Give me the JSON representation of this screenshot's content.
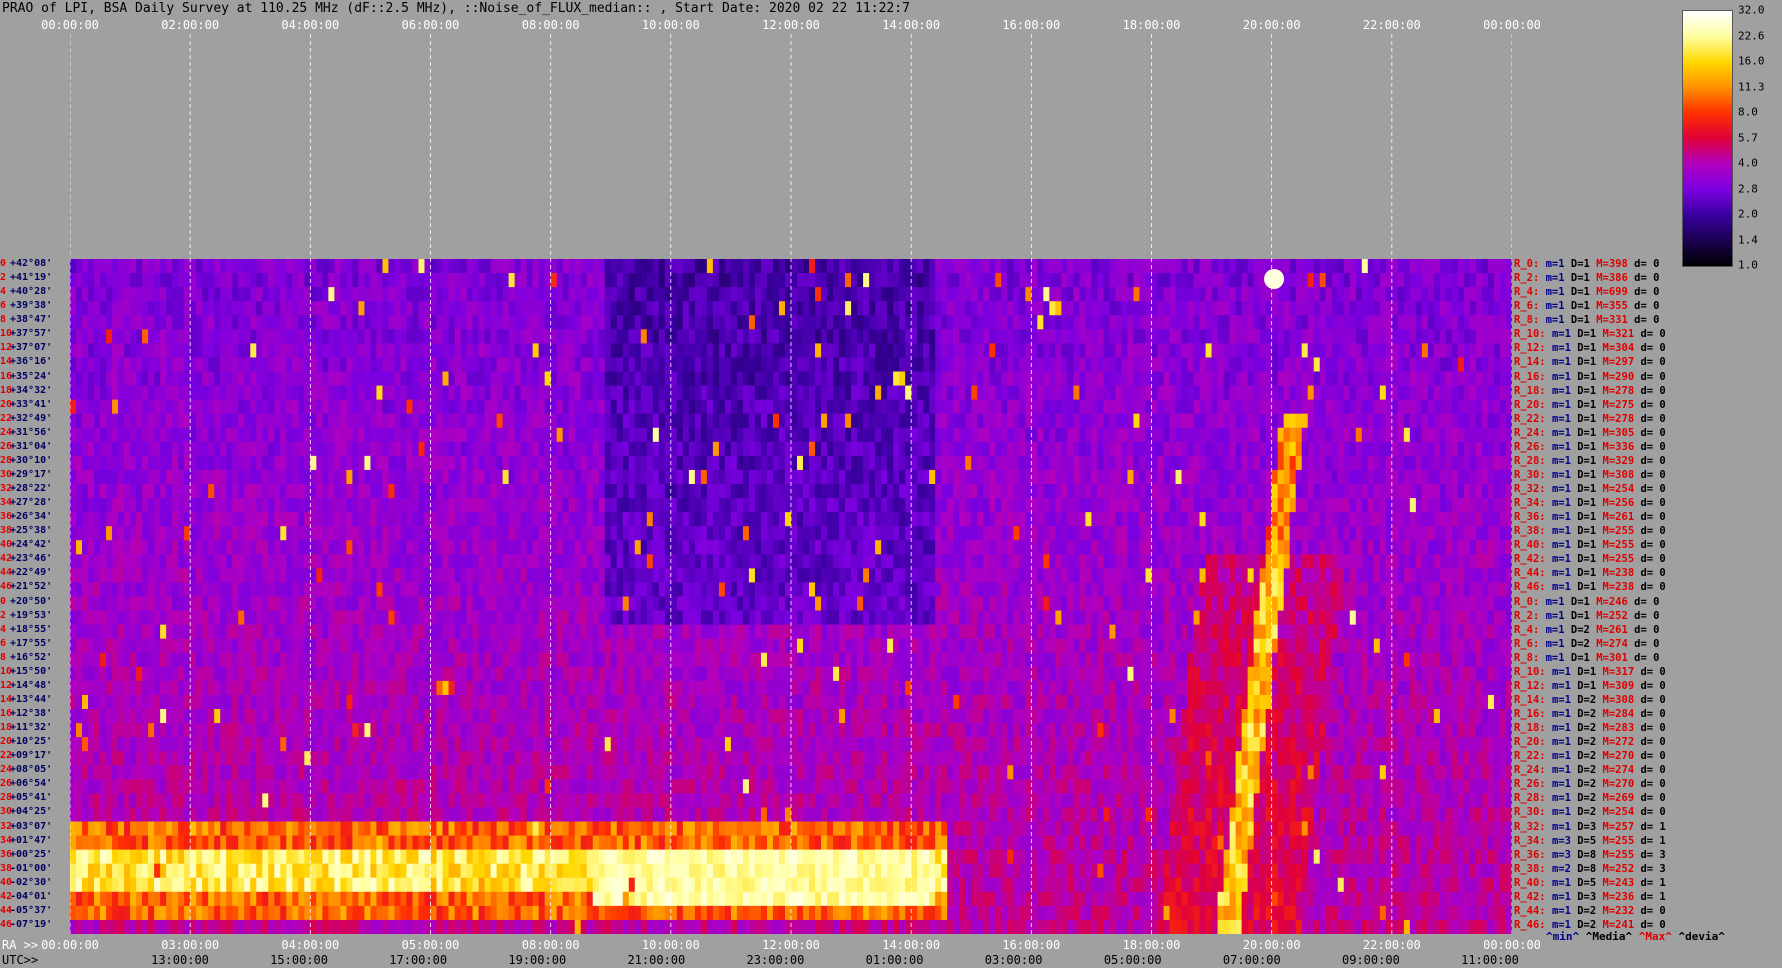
{
  "header": {
    "title": "PRAO of LPI, BSA Daily Survey at 110.25 MHz (dF::2.5 MHz), ::Noise_of_FLUX_median:: , Start Date: 2020 02 22 11:22:7"
  },
  "axes": {
    "top_ticks": [
      "00:00:00",
      "02:00:00",
      "04:00:00",
      "06:00:00",
      "08:00:00",
      "10:00:00",
      "12:00:00",
      "14:00:00",
      "16:00:00",
      "18:00:00",
      "20:00:00",
      "22:00:00",
      "00:00:00"
    ],
    "ra_prefix": "RA >>",
    "ra_ticks": [
      "00:00:00",
      "03:00:00",
      "04:00:00",
      "05:00:00",
      "08:00:00",
      "10:00:00",
      "12:00:00",
      "14:00:00",
      "16:00:00",
      "18:00:00",
      "20:00:00",
      "22:00:00",
      "00:00:00"
    ],
    "utc_prefix": "UTC>>",
    "utc_ticks": [
      "13:00:00",
      "15:00:00",
      "17:00:00",
      "19:00:00",
      "21:00:00",
      "23:00:00",
      "01:00:00",
      "03:00:00",
      "05:00:00",
      "07:00:00",
      "09:00:00",
      "11:00:00"
    ]
  },
  "declinations": [
    {
      "idx": "0",
      "dec": "+42°08'"
    },
    {
      "idx": "2",
      "dec": "+41°19'"
    },
    {
      "idx": "4",
      "dec": "+40°28'"
    },
    {
      "idx": "6",
      "dec": "+39°38'"
    },
    {
      "idx": "8",
      "dec": "+38°47'"
    },
    {
      "idx": "10",
      "dec": "+37°57'"
    },
    {
      "idx": "12",
      "dec": "+37°07'"
    },
    {
      "idx": "14",
      "dec": "+36°16'"
    },
    {
      "idx": "16",
      "dec": "+35°24'"
    },
    {
      "idx": "18",
      "dec": "+34°32'"
    },
    {
      "idx": "20",
      "dec": "+33°41'"
    },
    {
      "idx": "22",
      "dec": "+32°49'"
    },
    {
      "idx": "24",
      "dec": "+31°56'"
    },
    {
      "idx": "26",
      "dec": "+31°04'"
    },
    {
      "idx": "28",
      "dec": "+30°10'"
    },
    {
      "idx": "30",
      "dec": "+29°17'"
    },
    {
      "idx": "32",
      "dec": "+28°22'"
    },
    {
      "idx": "34",
      "dec": "+27°28'"
    },
    {
      "idx": "36",
      "dec": "+26°34'"
    },
    {
      "idx": "38",
      "dec": "+25°38'"
    },
    {
      "idx": "40",
      "dec": "+24°42'"
    },
    {
      "idx": "42",
      "dec": "+23°46'"
    },
    {
      "idx": "44",
      "dec": "+22°49'"
    },
    {
      "idx": "46",
      "dec": "+21°52'"
    },
    {
      "idx": "0",
      "dec": "+20°50'"
    },
    {
      "idx": "2",
      "dec": "+19°53'"
    },
    {
      "idx": "4",
      "dec": "+18°55'"
    },
    {
      "idx": "6",
      "dec": "+17°55'"
    },
    {
      "idx": "8",
      "dec": "+16°52'"
    },
    {
      "idx": "10",
      "dec": "+15°50'"
    },
    {
      "idx": "12",
      "dec": "+14°48'"
    },
    {
      "idx": "14",
      "dec": "+13°44'"
    },
    {
      "idx": "16",
      "dec": "+12°38'"
    },
    {
      "idx": "18",
      "dec": "+11°32'"
    },
    {
      "idx": "20",
      "dec": "+10°25'"
    },
    {
      "idx": "22",
      "dec": "+09°17'"
    },
    {
      "idx": "24",
      "dec": "+08°05'"
    },
    {
      "idx": "26",
      "dec": "+06°54'"
    },
    {
      "idx": "28",
      "dec": "+05°41'"
    },
    {
      "idx": "30",
      "dec": "+04°25'"
    },
    {
      "idx": "32",
      "dec": "+03°07'"
    },
    {
      "idx": "34",
      "dec": "+01°47'"
    },
    {
      "idx": "36",
      "dec": "+00°25'"
    },
    {
      "idx": "38",
      "dec": "-01°00'"
    },
    {
      "idx": "40",
      "dec": "-02°30'"
    },
    {
      "idx": "42",
      "dec": "-04°01'"
    },
    {
      "idx": "44",
      "dec": "-05°37'"
    },
    {
      "idx": "46",
      "dec": "-07°19'"
    }
  ],
  "stats": [
    {
      "r": "R_0:",
      "m": "m=1",
      "D": "D=1",
      "M": "M=398",
      "d": "d= 0"
    },
    {
      "r": "R_2:",
      "m": "m=1",
      "D": "D=1",
      "M": "M=386",
      "d": "d= 0"
    },
    {
      "r": "R_4:",
      "m": "m=1",
      "D": "D=1",
      "M": "M=699",
      "d": "d= 0"
    },
    {
      "r": "R_6:",
      "m": "m=1",
      "D": "D=1",
      "M": "M=355",
      "d": "d= 0"
    },
    {
      "r": "R_8:",
      "m": "m=1",
      "D": "D=1",
      "M": "M=331",
      "d": "d= 0"
    },
    {
      "r": "R_10:",
      "m": "m=1",
      "D": "D=1",
      "M": "M=321",
      "d": "d= 0"
    },
    {
      "r": "R_12:",
      "m": "m=1",
      "D": "D=1",
      "M": "M=304",
      "d": "d= 0"
    },
    {
      "r": "R_14:",
      "m": "m=1",
      "D": "D=1",
      "M": "M=297",
      "d": "d= 0"
    },
    {
      "r": "R_16:",
      "m": "m=1",
      "D": "D=1",
      "M": "M=290",
      "d": "d= 0"
    },
    {
      "r": "R_18:",
      "m": "m=1",
      "D": "D=1",
      "M": "M=278",
      "d": "d= 0"
    },
    {
      "r": "R_20:",
      "m": "m=1",
      "D": "D=1",
      "M": "M=275",
      "d": "d= 0"
    },
    {
      "r": "R_22:",
      "m": "m=1",
      "D": "D=1",
      "M": "M=278",
      "d": "d= 0"
    },
    {
      "r": "R_24:",
      "m": "m=1",
      "D": "D=1",
      "M": "M=305",
      "d": "d= 0"
    },
    {
      "r": "R_26:",
      "m": "m=1",
      "D": "D=1",
      "M": "M=336",
      "d": "d= 0"
    },
    {
      "r": "R_28:",
      "m": "m=1",
      "D": "D=1",
      "M": "M=329",
      "d": "d= 0"
    },
    {
      "r": "R_30:",
      "m": "m=1",
      "D": "D=1",
      "M": "M=308",
      "d": "d= 0"
    },
    {
      "r": "R_32:",
      "m": "m=1",
      "D": "D=1",
      "M": "M=254",
      "d": "d= 0"
    },
    {
      "r": "R_34:",
      "m": "m=1",
      "D": "D=1",
      "M": "M=256",
      "d": "d= 0"
    },
    {
      "r": "R_36:",
      "m": "m=1",
      "D": "D=1",
      "M": "M=261",
      "d": "d= 0"
    },
    {
      "r": "R_38:",
      "m": "m=1",
      "D": "D=1",
      "M": "M=255",
      "d": "d= 0"
    },
    {
      "r": "R_40:",
      "m": "m=1",
      "D": "D=1",
      "M": "M=255",
      "d": "d= 0"
    },
    {
      "r": "R_42:",
      "m": "m=1",
      "D": "D=1",
      "M": "M=255",
      "d": "d= 0"
    },
    {
      "r": "R_44:",
      "m": "m=1",
      "D": "D=1",
      "M": "M=238",
      "d": "d= 0"
    },
    {
      "r": "R_46:",
      "m": "m=1",
      "D": "D=1",
      "M": "M=238",
      "d": "d= 0"
    },
    {
      "r": "R_0:",
      "m": "m=1",
      "D": "D=1",
      "M": "M=246",
      "d": "d= 0"
    },
    {
      "r": "R_2:",
      "m": "m=1",
      "D": "D=1",
      "M": "M=252",
      "d": "d= 0"
    },
    {
      "r": "R_4:",
      "m": "m=1",
      "D": "D=2",
      "M": "M=261",
      "d": "d= 0"
    },
    {
      "r": "R_6:",
      "m": "m=1",
      "D": "D=2",
      "M": "M=274",
      "d": "d= 0"
    },
    {
      "r": "R_8:",
      "m": "m=1",
      "D": "D=1",
      "M": "M=301",
      "d": "d= 0"
    },
    {
      "r": "R_10:",
      "m": "m=1",
      "D": "D=1",
      "M": "M=317",
      "d": "d= 0"
    },
    {
      "r": "R_12:",
      "m": "m=1",
      "D": "D=1",
      "M": "M=309",
      "d": "d= 0"
    },
    {
      "r": "R_14:",
      "m": "m=1",
      "D": "D=2",
      "M": "M=308",
      "d": "d= 0"
    },
    {
      "r": "R_16:",
      "m": "m=1",
      "D": "D=2",
      "M": "M=284",
      "d": "d= 0"
    },
    {
      "r": "R_18:",
      "m": "m=1",
      "D": "D=2",
      "M": "M=283",
      "d": "d= 0"
    },
    {
      "r": "R_20:",
      "m": "m=1",
      "D": "D=2",
      "M": "M=272",
      "d": "d= 0"
    },
    {
      "r": "R_22:",
      "m": "m=1",
      "D": "D=2",
      "M": "M=270",
      "d": "d= 0"
    },
    {
      "r": "R_24:",
      "m": "m=1",
      "D": "D=2",
      "M": "M=274",
      "d": "d= 0"
    },
    {
      "r": "R_26:",
      "m": "m=1",
      "D": "D=2",
      "M": "M=270",
      "d": "d= 0"
    },
    {
      "r": "R_28:",
      "m": "m=1",
      "D": "D=2",
      "M": "M=269",
      "d": "d= 0"
    },
    {
      "r": "R_30:",
      "m": "m=1",
      "D": "D=2",
      "M": "M=254",
      "d": "d= 0"
    },
    {
      "r": "R_32:",
      "m": "m=1",
      "D": "D=3",
      "M": "M=257",
      "d": "d= 1"
    },
    {
      "r": "R_34:",
      "m": "m=3",
      "D": "D=5",
      "M": "M=255",
      "d": "d= 1"
    },
    {
      "r": "R_36:",
      "m": "m=3",
      "D": "D=8",
      "M": "M=255",
      "d": "d= 3"
    },
    {
      "r": "R_38:",
      "m": "m=2",
      "D": "D=8",
      "M": "M=252",
      "d": "d= 3"
    },
    {
      "r": "R_40:",
      "m": "m=1",
      "D": "D=5",
      "M": "M=243",
      "d": "d= 1"
    },
    {
      "r": "R_42:",
      "m": "m=1",
      "D": "D=3",
      "M": "M=236",
      "d": "d= 1"
    },
    {
      "r": "R_44:",
      "m": "m=1",
      "D": "D=2",
      "M": "M=232",
      "d": "d= 0"
    },
    {
      "r": "R_46:",
      "m": "m=1",
      "D": "D=2",
      "M": "M=241",
      "d": "d= 0"
    }
  ],
  "stat_legend": {
    "min": "^min^",
    "media": "^Media^",
    "max": "^Max^",
    "devia": "^devia^"
  },
  "colorbar": {
    "ticks": [
      "32.0",
      "22.6",
      "16.0",
      "11.3",
      "8.0",
      "5.7",
      "4.0",
      "2.8",
      "2.0",
      "1.4",
      "1.0"
    ],
    "colors": [
      "#000000",
      "#1a0050",
      "#3a00a0",
      "#7a00e0",
      "#b000c0",
      "#e0003a",
      "#ff3000",
      "#ff9000",
      "#ffd800",
      "#ffffa0",
      "#ffffff"
    ]
  },
  "chart_data": {
    "type": "heatmap",
    "title": "PRAO of LPI, BSA Daily Survey at 110.25 MHz (dF::2.5 MHz), ::Noise_of_FLUX_median:: , Start Date: 2020 02 22 11:22:7",
    "x_axis": "RA / UTC time (00:00:00 to 24:00:00)",
    "y_axis": "Declination (+42°08' to -07°19')",
    "value_range": [
      1.0,
      32.0
    ],
    "scale": "log2",
    "features": [
      {
        "name": "strong equatorial band",
        "dec_range": [
          "+01°47'",
          "-05°37'"
        ],
        "ra_range": [
          "00:00:00",
          "14:30:00"
        ],
        "level": "high"
      },
      {
        "name": "diagonal bright track",
        "ra_range": [
          "17:40:00",
          "20:20:00"
        ],
        "level": "high"
      },
      {
        "name": "bright source",
        "ra": "20:00:00",
        "dec": "+41°19'",
        "level": "max"
      }
    ]
  }
}
